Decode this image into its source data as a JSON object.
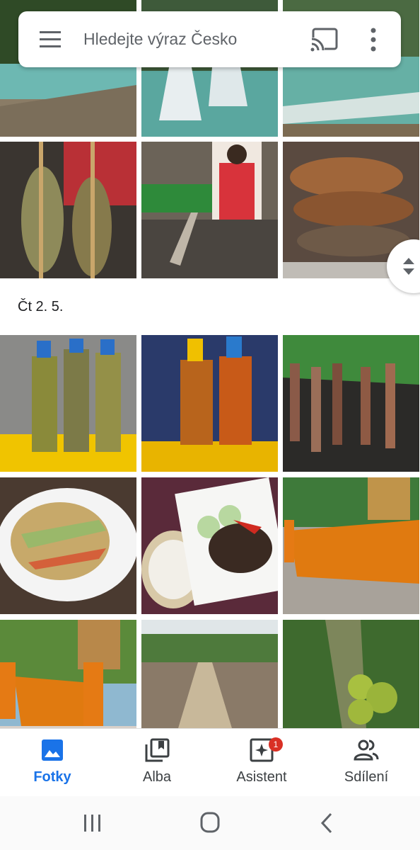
{
  "search": {
    "placeholder": "Hledejte výraz Česko"
  },
  "date_header": "Čt 2. 5.",
  "nav": {
    "items": [
      {
        "label": "Fotky",
        "icon": "photo-icon",
        "active": true
      },
      {
        "label": "Alba",
        "icon": "album-icon",
        "active": false
      },
      {
        "label": "Asistent",
        "icon": "assistant-icon",
        "active": false,
        "badge": "1"
      },
      {
        "label": "Sdílení",
        "icon": "people-icon",
        "active": false
      }
    ]
  },
  "photos": [
    "waterfall",
    "waterfall",
    "waterfall",
    "grilled-fish",
    "street-vendor",
    "grilled-meat",
    "snake-whisky",
    "scorpion-whisky",
    "meat-skewers",
    "papaya-salad",
    "laap-with-rice",
    "monks-with-robe",
    "monks-with-robe",
    "bamboo-bridge",
    "jackfruit-tree"
  ],
  "colors": {
    "accent": "#1a73e8",
    "badge": "#d93025"
  }
}
